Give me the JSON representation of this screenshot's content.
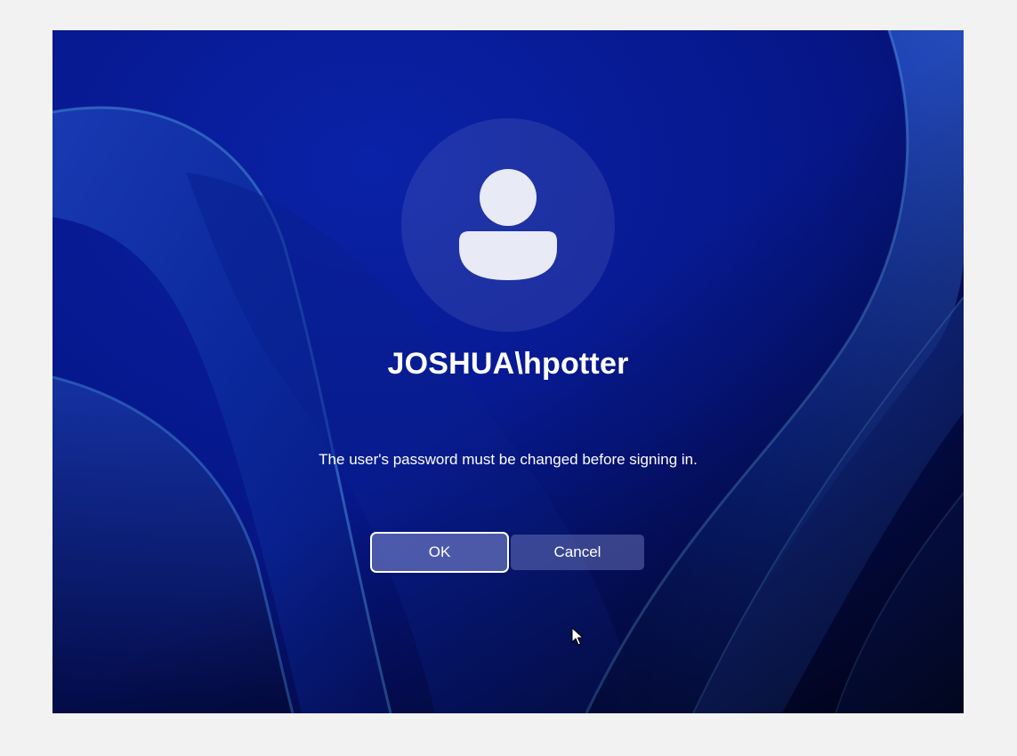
{
  "lock_screen": {
    "username": "JOSHUA\\hpotter",
    "message": "The user's password must be changed before signing in.",
    "ok_label": "OK",
    "cancel_label": "Cancel",
    "avatar_icon": "person-icon",
    "colors": {
      "background_dark": "#020835",
      "background_blue": "#0a1d9a",
      "ribbon_light": "#3f7cd6",
      "button_fill": "#5a64b4",
      "text": "#ffffff"
    }
  }
}
